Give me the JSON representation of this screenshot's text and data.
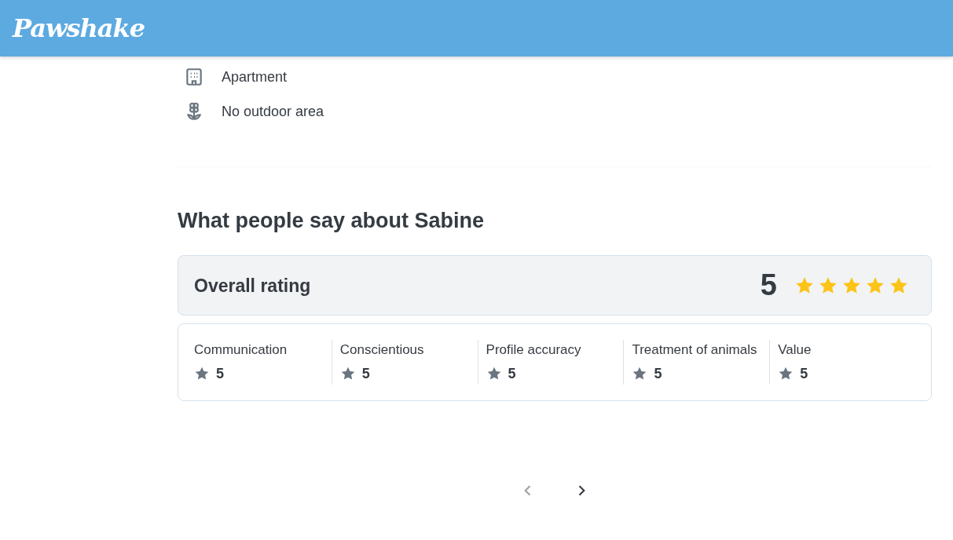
{
  "header": {
    "logo": "Pawshake"
  },
  "home_features": [
    {
      "kind": "building",
      "label": "Apartment"
    },
    {
      "kind": "flower",
      "label": "No outdoor area"
    }
  ],
  "reviews": {
    "title": "What people say about Sabine",
    "overall": {
      "label": "Overall rating",
      "score": "5",
      "stars": 5
    },
    "categories": [
      {
        "label": "Communication",
        "score": "5"
      },
      {
        "label": "Conscientious",
        "score": "5"
      },
      {
        "label": "Profile accuracy",
        "score": "5"
      },
      {
        "label": "Treatment of animals",
        "score": "5"
      },
      {
        "label": "Value",
        "score": "5"
      }
    ]
  },
  "pager": {
    "prev_disabled": true,
    "next_disabled": false
  }
}
